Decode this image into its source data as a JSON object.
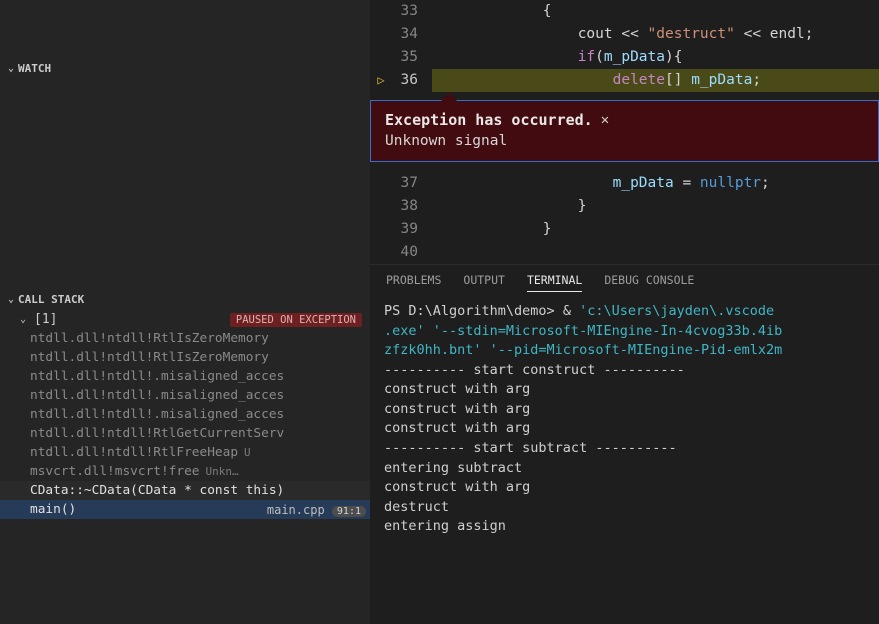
{
  "sidebar": {
    "watch_label": "WATCH",
    "callstack_label": "CALL STACK",
    "thread": {
      "name": "[1]",
      "state": "PAUSED ON EXCEPTION"
    },
    "frames": [
      {
        "label": "ntdll.dll!ntdll!RtlIsZeroMemory"
      },
      {
        "label": "ntdll.dll!ntdll!RtlIsZeroMemory"
      },
      {
        "label": "ntdll.dll!ntdll!.misaligned_acces"
      },
      {
        "label": "ntdll.dll!ntdll!.misaligned_acces"
      },
      {
        "label": "ntdll.dll!ntdll!.misaligned_acces"
      },
      {
        "label": "ntdll.dll!ntdll!RtlGetCurrentServ"
      },
      {
        "label": "ntdll.dll!ntdll!RtlFreeHeap",
        "extra": "U"
      },
      {
        "label": "msvcrt.dll!msvcrt!free",
        "extra": "Unkn…"
      },
      {
        "label": "CData::~CData(CData * const this)",
        "bright": true
      },
      {
        "label": "main()",
        "file": "main.cpp",
        "line": "91:1",
        "active": true
      }
    ]
  },
  "editor": {
    "lines": [
      {
        "n": "33",
        "html": "            <span class='tk-punc'>{</span>"
      },
      {
        "n": "34",
        "html": "                <span class='tk-ident'>cout</span> <span class='tk-op'>&lt;&lt;</span> <span class='tk-str'>\"destruct\"</span> <span class='tk-op'>&lt;&lt;</span> <span class='tk-ident'>endl</span><span class='tk-punc'>;</span>"
      },
      {
        "n": "35",
        "html": "                <span class='tk-kw'>if</span><span class='tk-punc'>(</span><span class='tk-var'>m_pData</span><span class='tk-punc'>){</span>"
      },
      {
        "n": "36",
        "cur": true,
        "html": "                    <span class='tk-kw'>delete</span><span class='tk-punc'>[]</span> <span class='tk-var'>m_pData</span><span class='tk-punc'>;</span>"
      }
    ],
    "exception": {
      "title": "Exception has occurred.",
      "message": "Unknown signal"
    },
    "lines2": [
      {
        "n": "37",
        "html": "                    <span class='tk-var'>m_pData</span> <span class='tk-op'>=</span> <span class='tk-null'>nullptr</span><span class='tk-punc'>;</span>"
      },
      {
        "n": "38",
        "html": "                <span class='tk-punc'>}</span>"
      },
      {
        "n": "39",
        "html": "            <span class='tk-punc'>}</span>"
      },
      {
        "n": "40",
        "html": ""
      }
    ]
  },
  "panel": {
    "tabs": {
      "problems": "PROBLEMS",
      "output": "OUTPUT",
      "terminal": "TERMINAL",
      "debug": "DEBUG CONSOLE"
    },
    "terminal": {
      "prompt": "PS D:\\Algorithm\\demo> ",
      "amp": "& ",
      "cmd1": "'c:\\Users\\jayden\\.vscode",
      "cmd2": ".exe' '--stdin=Microsoft-MIEngine-In-4cvog33b.4ib",
      "cmd3": "zfzk0hh.bnt' '--pid=Microsoft-MIEngine-Pid-emlx2m",
      "out": [
        "---------- start construct ----------",
        "construct with arg",
        "construct with arg",
        "construct with arg",
        "---------- start subtract ----------",
        "entering subtract",
        "construct with arg",
        "destruct",
        "entering assign"
      ]
    }
  }
}
